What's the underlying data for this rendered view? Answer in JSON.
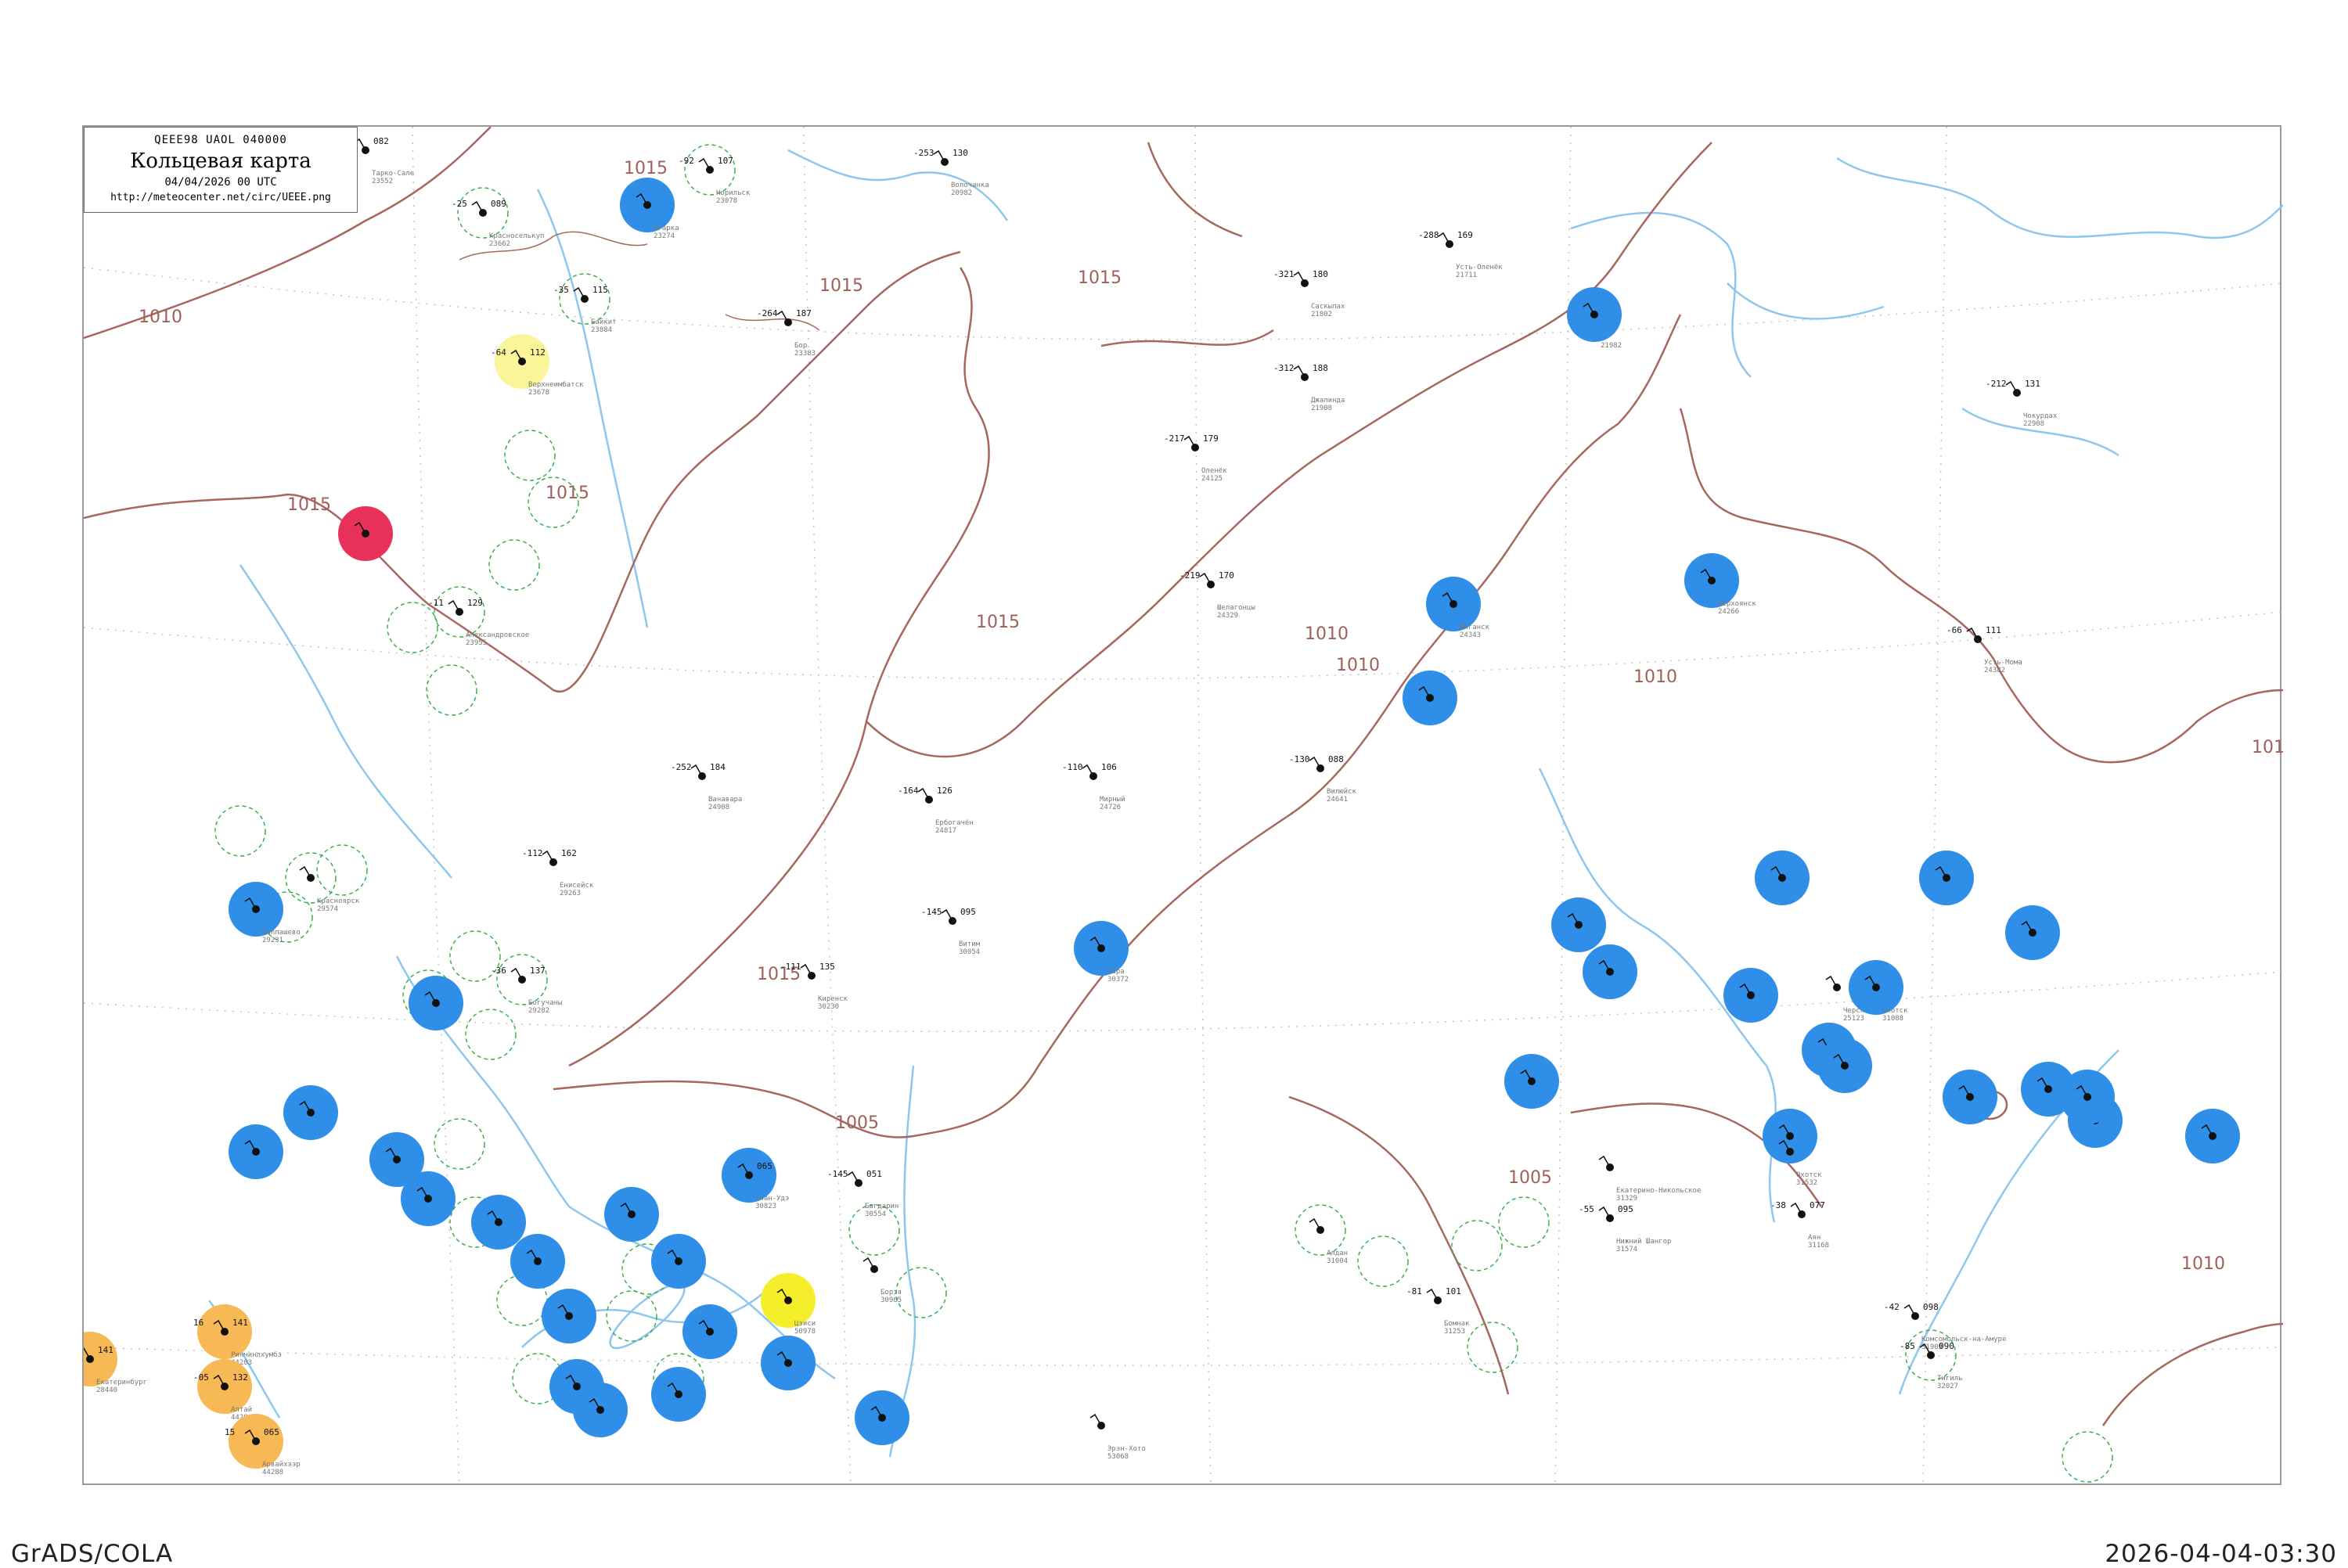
{
  "title_box": {
    "code": "QEEE98  UAOL  040000",
    "name": "Кольцевая карта",
    "date": "04/04/2026 00 UTC",
    "url": "http://meteocenter.net/circ/UEEE.png"
  },
  "footer": {
    "left": "GrADS/COLA",
    "right": "2026-04-04-03:30"
  },
  "colors": {
    "isobar": "#a8675e",
    "water": "#8ec7ee",
    "blue_marker": "#2f8fe8",
    "orange_marker": "#f7b955",
    "yellow_marker": "#f5ee2a",
    "pale_yellow_marker": "#fbf59a",
    "red_marker": "#e8315a",
    "green_ring": "#3bb04a",
    "grid": "#bbbbbb"
  },
  "isobar_labels": [
    {
      "text": "1010"
    },
    {
      "text": "1015"
    },
    {
      "text": "1015"
    },
    {
      "text": "1015"
    },
    {
      "text": "1015"
    },
    {
      "text": "1015"
    },
    {
      "text": "1015"
    },
    {
      "text": "1010"
    },
    {
      "text": "1010"
    },
    {
      "text": "1015"
    },
    {
      "text": "1010"
    },
    {
      "text": "1005"
    },
    {
      "text": "1005"
    },
    {
      "text": "1010"
    },
    {
      "text": "101"
    }
  ],
  "stations": [
    {
      "id": "23552",
      "name": "Тарко-Сале",
      "p": "082",
      "t": "-06"
    },
    {
      "id": "23662",
      "name": "Красноселькуп",
      "p": "089",
      "t": "-25"
    },
    {
      "id": "23274",
      "name": "Игарка",
      "p": "",
      "t": ""
    },
    {
      "id": "23078",
      "name": "Норильск",
      "p": "107",
      "t": "-92"
    },
    {
      "id": "20982",
      "name": "Волочанка",
      "p": "130",
      "t": "-253"
    },
    {
      "id": "21802",
      "name": "Саскылах",
      "p": "180",
      "t": "-321"
    },
    {
      "id": "21711",
      "name": "Усть-Оленёк",
      "p": "169",
      "t": "-288"
    },
    {
      "id": "21908",
      "name": "Джалинда",
      "p": "188",
      "t": "-312"
    },
    {
      "id": "21982",
      "name": "",
      "p": "",
      "t": ""
    },
    {
      "id": "22908",
      "name": "Чокурдах",
      "p": "131",
      "t": "-212"
    },
    {
      "id": "23383",
      "name": "Бор",
      "p": "187",
      "t": "-264"
    },
    {
      "id": "23678",
      "name": "Верхнеимбатск",
      "p": "112",
      "t": "-64"
    },
    {
      "id": "23884",
      "name": "Байкит",
      "p": "115",
      "t": "-35"
    },
    {
      "id": "23955",
      "name": "Александровское",
      "p": "129",
      "t": "-11"
    },
    {
      "id": "24125",
      "name": "Оленёк",
      "p": "179",
      "t": "-217"
    },
    {
      "id": "24329",
      "name": "Шелагонцы",
      "p": "170",
      "t": "-219"
    },
    {
      "id": "24382",
      "name": "Усть-Мома",
      "p": "111",
      "t": "-66"
    },
    {
      "id": "24266",
      "name": "Верхоянск",
      "p": "",
      "t": ""
    },
    {
      "id": "24343",
      "name": "Жиганск",
      "p": "",
      "t": ""
    },
    {
      "id": "24641",
      "name": "Вилюйск",
      "p": "088",
      "t": "-130"
    },
    {
      "id": "24726",
      "name": "Мирный",
      "p": "106",
      "t": "-110"
    },
    {
      "id": "24817",
      "name": "Ербогачён",
      "p": "126",
      "t": "-164"
    },
    {
      "id": "24908",
      "name": "Ванавара",
      "p": "184",
      "t": "-252"
    },
    {
      "id": "25123",
      "name": "Черский",
      "p": "",
      "t": ""
    },
    {
      "id": "28440",
      "name": "Екатеринбург",
      "p": "141",
      "t": "2"
    },
    {
      "id": "29231",
      "name": "Колпашево",
      "p": "",
      "t": ""
    },
    {
      "id": "29282",
      "name": "Богучаны",
      "p": "137",
      "t": "-36"
    },
    {
      "id": "29263",
      "name": "Енисейск",
      "p": "162",
      "t": "-112"
    },
    {
      "id": "29574",
      "name": "Красноярск",
      "p": "",
      "t": ""
    },
    {
      "id": "30054",
      "name": "Витим",
      "p": "095",
      "t": "-145"
    },
    {
      "id": "30230",
      "name": "Киренск",
      "p": "135",
      "t": "-111"
    },
    {
      "id": "30372",
      "name": "Чара",
      "p": "",
      "t": ""
    },
    {
      "id": "30554",
      "name": "Багдарин",
      "p": "051",
      "t": "-145"
    },
    {
      "id": "30823",
      "name": "Улан-Удэ",
      "p": "065",
      "t": ""
    },
    {
      "id": "30965",
      "name": "Борзя",
      "p": "",
      "t": ""
    },
    {
      "id": "31004",
      "name": "Алдан",
      "p": "",
      "t": ""
    },
    {
      "id": "31088",
      "name": "Охотск",
      "p": "",
      "t": ""
    },
    {
      "id": "31168",
      "name": "Аян",
      "p": "077",
      "t": "-38"
    },
    {
      "id": "31253",
      "name": "Бомнак",
      "p": "101",
      "t": "-81"
    },
    {
      "id": "31329",
      "name": "Екатерино-Никольское",
      "p": "",
      "t": ""
    },
    {
      "id": "31532",
      "name": "Охотск",
      "p": "",
      "t": ""
    },
    {
      "id": "31574",
      "name": "Нижний Шангор",
      "p": "095",
      "t": "-55"
    },
    {
      "id": "31909",
      "name": "Комсомольск-на-Амуре",
      "p": "098",
      "t": "-42"
    },
    {
      "id": "32027",
      "name": "Тигиль",
      "p": "090",
      "t": "-85"
    },
    {
      "id": "44203",
      "name": "Ринчинлхумбэ",
      "p": "141",
      "t": "16"
    },
    {
      "id": "44284",
      "name": "Алтай",
      "p": "132",
      "t": "-05"
    },
    {
      "id": "44288",
      "name": "Арвайхээр",
      "p": "065",
      "t": "15"
    },
    {
      "id": "50978",
      "name": "Цзиси",
      "p": "",
      "t": ""
    },
    {
      "id": "53068",
      "name": "Эрэн-Хото",
      "p": "",
      "t": ""
    }
  ]
}
